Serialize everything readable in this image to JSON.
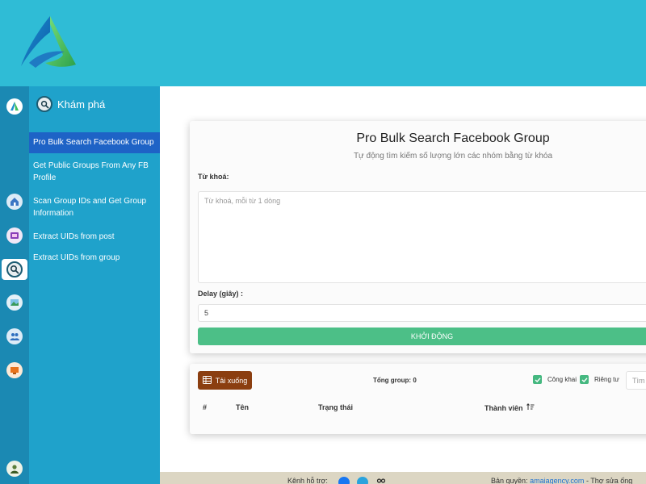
{
  "header": {
    "logo_icon": "app-logo-icon"
  },
  "icon_rail": {
    "items": [
      {
        "icon": "app-logo-icon",
        "active": false
      },
      {
        "icon": "home-icon",
        "active": false
      },
      {
        "icon": "gallery-icon",
        "active": false
      },
      {
        "icon": "search-scope-icon",
        "active": true
      },
      {
        "icon": "landscape-icon",
        "active": false
      },
      {
        "icon": "users-icon",
        "active": false
      },
      {
        "icon": "screen-icon",
        "active": false
      },
      {
        "icon": "user-avatar-icon",
        "active": false
      }
    ]
  },
  "menu": {
    "title": "Khám phá",
    "items": [
      {
        "label": "Pro Bulk Search Facebook Group",
        "active": true
      },
      {
        "label": "Get Public Groups From Any FB Profile",
        "active": false
      },
      {
        "label": "Scan Group IDs and Get Group Information",
        "active": false
      },
      {
        "label": "Extract UIDs from post",
        "active": false
      },
      {
        "label": "Extract UIDs from group",
        "active": false
      }
    ]
  },
  "form": {
    "title": "Pro Bulk Search Facebook Group",
    "subtitle": "Tự động tìm kiếm số lượng lớn các nhóm bằng từ khóa",
    "keyword_label": "Từ khoá:",
    "keyword_placeholder": "Từ khoá, mỗi từ 1 dòng",
    "keyword_value": "",
    "delay_label": "Delay (giây) :",
    "delay_value": "5",
    "start_label": "KHỞI ĐỘNG"
  },
  "results": {
    "download_label": "Tải xuống",
    "total_label": "Tổng group:",
    "total_value": "0",
    "public_label": "Công khai",
    "public_checked": true,
    "private_label": "Riêng tư",
    "private_checked": true,
    "search_placeholder": "Tìm",
    "columns": [
      "#",
      "Tên",
      "Trạng thái",
      "Thành viên"
    ]
  },
  "footer": {
    "support_label": "Kênh hỗ trợ:",
    "copyright_label": "Bản quyền:",
    "copyright_link": "amaiagency.com",
    "separator": "-",
    "trailing_text": "Thợ sửa ống"
  },
  "colors": {
    "topbar": "#2fbcd6",
    "rail": "#1b89b3",
    "menu": "#1fa2cb",
    "menu_active": "#1e63c6",
    "start_button": "#4cbf87",
    "download_button": "#8b3e10",
    "checkbox": "#45b880"
  }
}
